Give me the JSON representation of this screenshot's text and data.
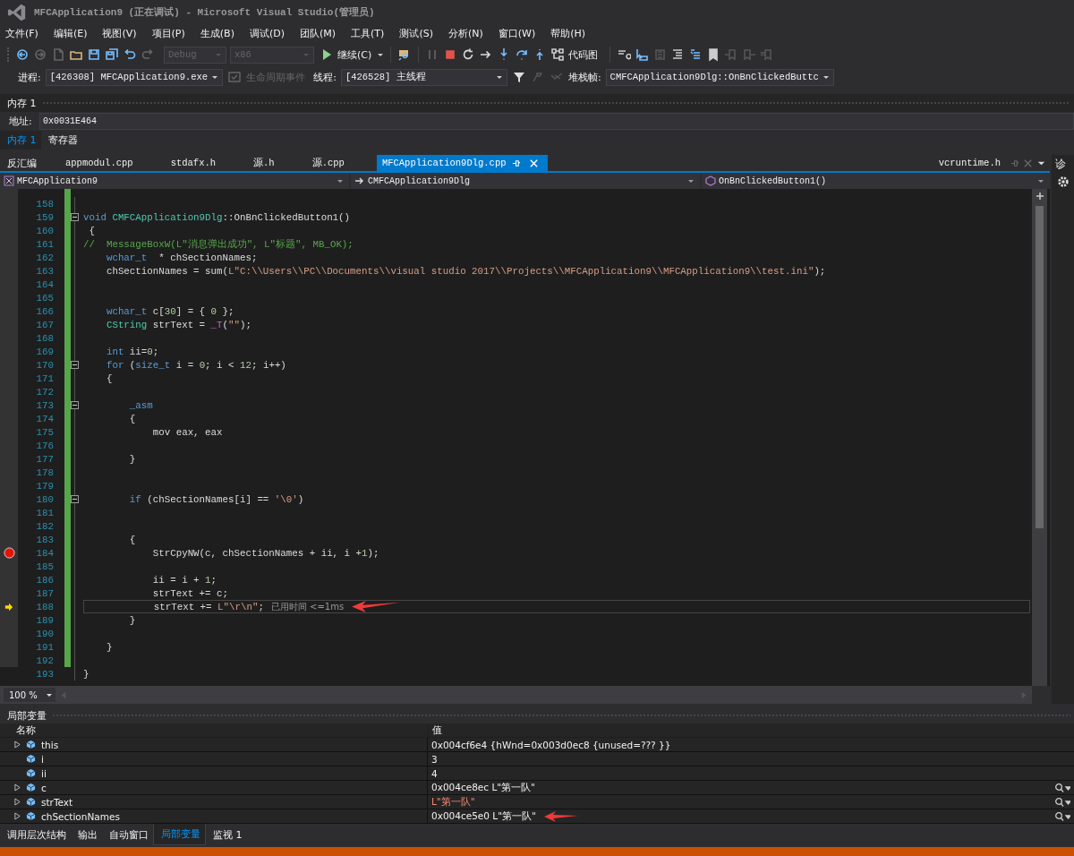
{
  "window": {
    "title": "MFCApplication9 (正在调试) - Microsoft Visual Studio(管理员)"
  },
  "menu": [
    "文件(F)",
    "编辑(E)",
    "视图(V)",
    "项目(P)",
    "生成(B)",
    "调试(D)",
    "团队(M)",
    "工具(T)",
    "测试(S)",
    "分析(N)",
    "窗口(W)",
    "帮助(H)"
  ],
  "toolbar": {
    "config": "Debug",
    "platform": "x86",
    "continue": "继续(C)",
    "codemap": "代码图"
  },
  "debug_location": {
    "process_label": "进程:",
    "process": "[426308] MFCApplication9.exe",
    "lifecycle": "生命周期事件",
    "thread_label": "线程:",
    "thread": "[426528] 主线程",
    "stack_label": "堆栈帧:",
    "stack": "CMFCApplication9Dlg::OnBnClickedButtc"
  },
  "memory_panel": {
    "title": "内存 1",
    "address_label": "地址:",
    "address": "0x0031E464",
    "tabs": [
      {
        "label": "内存 1",
        "selected": true
      },
      {
        "label": "寄存器",
        "selected": false
      }
    ]
  },
  "doc_tabs": [
    {
      "label": "反汇编",
      "selected": false
    },
    {
      "label": "appmodul.cpp",
      "selected": false
    },
    {
      "label": "stdafx.h",
      "selected": false
    },
    {
      "label": "源.h",
      "selected": false
    },
    {
      "label": "源.cpp",
      "selected": false
    },
    {
      "label": "MFCApplication9Dlg.cpp",
      "selected": true
    }
  ],
  "preview_tab": "vcruntime.h",
  "nav": {
    "project": "MFCApplication9",
    "class": "CMFCApplication9Dlg",
    "member": "OnBnClickedButton1()"
  },
  "side_panel": {
    "title": "诊"
  },
  "code": [
    {
      "n": "158"
    },
    {
      "n": "159",
      "fold": true,
      "segs": [
        {
          "kind": "kw",
          "t": "void "
        },
        {
          "kind": "type",
          "t": "CMFCApplication9Dlg"
        },
        {
          "kind": "p",
          "t": "::OnBnClickedButton1()"
        }
      ]
    },
    {
      "n": "160",
      "segs": [
        {
          "kind": "p",
          "t": " {"
        }
      ]
    },
    {
      "n": "161",
      "segs": [
        {
          "kind": "cm",
          "t": "//  MessageBoxW(L\"消息弹出成功\", L\"标题\", MB_OK);"
        }
      ]
    },
    {
      "n": "162",
      "segs": [
        {
          "kind": "kw",
          "t": "    wchar_t"
        },
        {
          "kind": "p",
          "t": "  * chSectionNames;"
        }
      ]
    },
    {
      "n": "163",
      "segs": [
        {
          "kind": "p",
          "t": "    chSectionNames = sum("
        },
        {
          "kind": "str",
          "t": "L\"C:\\\\Users\\\\PC\\\\Documents\\\\visual studio 2017\\\\Projects\\\\MFCApplication9\\\\MFCApplication9\\\\test.ini\""
        },
        {
          "kind": "p",
          "t": ");"
        }
      ]
    },
    {
      "n": "164"
    },
    {
      "n": "165"
    },
    {
      "n": "166",
      "segs": [
        {
          "kind": "kw",
          "t": "    wchar_t"
        },
        {
          "kind": "p",
          "t": " c["
        },
        {
          "kind": "num",
          "t": "30"
        },
        {
          "kind": "p",
          "t": "] = { "
        },
        {
          "kind": "num",
          "t": "0"
        },
        {
          "kind": "p",
          "t": " };"
        }
      ]
    },
    {
      "n": "167",
      "segs": [
        {
          "kind": "type",
          "t": "    CString"
        },
        {
          "kind": "p",
          "t": " strText = "
        },
        {
          "kind": "macro",
          "t": "_T"
        },
        {
          "kind": "p",
          "t": "("
        },
        {
          "kind": "str",
          "t": "\"\""
        },
        {
          "kind": "p",
          "t": ");"
        }
      ]
    },
    {
      "n": "168"
    },
    {
      "n": "169",
      "segs": [
        {
          "kind": "kw",
          "t": "    int"
        },
        {
          "kind": "p",
          "t": " ii="
        },
        {
          "kind": "num",
          "t": "0"
        },
        {
          "kind": "p",
          "t": ";"
        }
      ]
    },
    {
      "n": "170",
      "fold": true,
      "segs": [
        {
          "kind": "kw",
          "t": "    for"
        },
        {
          "kind": "p",
          "t": " ("
        },
        {
          "kind": "kw",
          "t": "size_t"
        },
        {
          "kind": "p",
          "t": " i = "
        },
        {
          "kind": "num",
          "t": "0"
        },
        {
          "kind": "p",
          "t": "; i < "
        },
        {
          "kind": "num",
          "t": "12"
        },
        {
          "kind": "p",
          "t": "; i++)"
        }
      ]
    },
    {
      "n": "171",
      "segs": [
        {
          "kind": "p",
          "t": "    {"
        }
      ]
    },
    {
      "n": "172"
    },
    {
      "n": "173",
      "fold": true,
      "segs": [
        {
          "kind": "kw",
          "t": "        _asm"
        }
      ]
    },
    {
      "n": "174",
      "segs": [
        {
          "kind": "p",
          "t": "        {"
        }
      ]
    },
    {
      "n": "175",
      "segs": [
        {
          "kind": "p",
          "t": "            mov eax, eax"
        }
      ]
    },
    {
      "n": "176"
    },
    {
      "n": "177",
      "segs": [
        {
          "kind": "p",
          "t": "        }"
        }
      ]
    },
    {
      "n": "178"
    },
    {
      "n": "179"
    },
    {
      "n": "180",
      "fold": true,
      "segs": [
        {
          "kind": "kw",
          "t": "        if"
        },
        {
          "kind": "p",
          "t": " (chSectionNames[i] == "
        },
        {
          "kind": "str",
          "t": "'\\0'"
        },
        {
          "kind": "p",
          "t": ")"
        }
      ]
    },
    {
      "n": "181"
    },
    {
      "n": "182"
    },
    {
      "n": "183",
      "segs": [
        {
          "kind": "p",
          "t": "        {"
        }
      ]
    },
    {
      "n": "184",
      "kind": "breakpoint",
      "segs": [
        {
          "kind": "p",
          "t": "            StrCpyNW(c, chSectionNames + ii, i +"
        },
        {
          "kind": "num",
          "t": "1"
        },
        {
          "kind": "p",
          "t": ");"
        }
      ]
    },
    {
      "n": "185"
    },
    {
      "n": "186",
      "segs": [
        {
          "kind": "p",
          "t": "            ii = i + "
        },
        {
          "kind": "num",
          "t": "1"
        },
        {
          "kind": "p",
          "t": ";"
        }
      ]
    },
    {
      "n": "187",
      "segs": [
        {
          "kind": "p",
          "t": "            strText += c;"
        }
      ]
    },
    {
      "n": "188",
      "kind": "current",
      "hint": "已用时间 <=1ms",
      "segs": [
        {
          "kind": "p",
          "t": "            strText += "
        },
        {
          "kind": "str",
          "t": "L\"\\r\\n\""
        },
        {
          "kind": "p",
          "t": ";"
        }
      ]
    },
    {
      "n": "189",
      "segs": [
        {
          "kind": "p",
          "t": "        }"
        }
      ]
    },
    {
      "n": "190"
    },
    {
      "n": "191",
      "segs": [
        {
          "kind": "p",
          "t": "    }"
        }
      ]
    },
    {
      "n": "192"
    },
    {
      "n": "193",
      "segs": [
        {
          "kind": "p",
          "t": "}"
        }
      ]
    }
  ],
  "zoom": "100 %",
  "locals": {
    "title": "局部变量",
    "columns": [
      "名称",
      "值"
    ],
    "rows": [
      {
        "name": "this",
        "value": "0x004cf6e4 {hWnd=0x003d0ec8 {unused=??? }}",
        "expandable": true,
        "changed": false,
        "viewer": false
      },
      {
        "name": "i",
        "value": "3",
        "expandable": false,
        "changed": false,
        "viewer": false
      },
      {
        "name": "ii",
        "value": "4",
        "expandable": false,
        "changed": false,
        "viewer": false
      },
      {
        "name": "c",
        "value": "0x004ce8ec L\"第一队\"",
        "expandable": true,
        "changed": false,
        "viewer": true
      },
      {
        "name": "strText",
        "value": "L\"第一队\"",
        "expandable": true,
        "changed": true,
        "viewer": true
      },
      {
        "name": "chSectionNames",
        "value": "0x004ce5e0 L\"第一队\"",
        "expandable": true,
        "changed": false,
        "viewer": true,
        "annotated": true
      }
    ]
  },
  "bottom_tabs": [
    {
      "label": "调用层次结构",
      "selected": false
    },
    {
      "label": "输出",
      "selected": false
    },
    {
      "label": "自动窗口",
      "selected": false
    },
    {
      "label": "局部变量",
      "selected": true
    },
    {
      "label": "监视 1",
      "selected": false
    }
  ]
}
